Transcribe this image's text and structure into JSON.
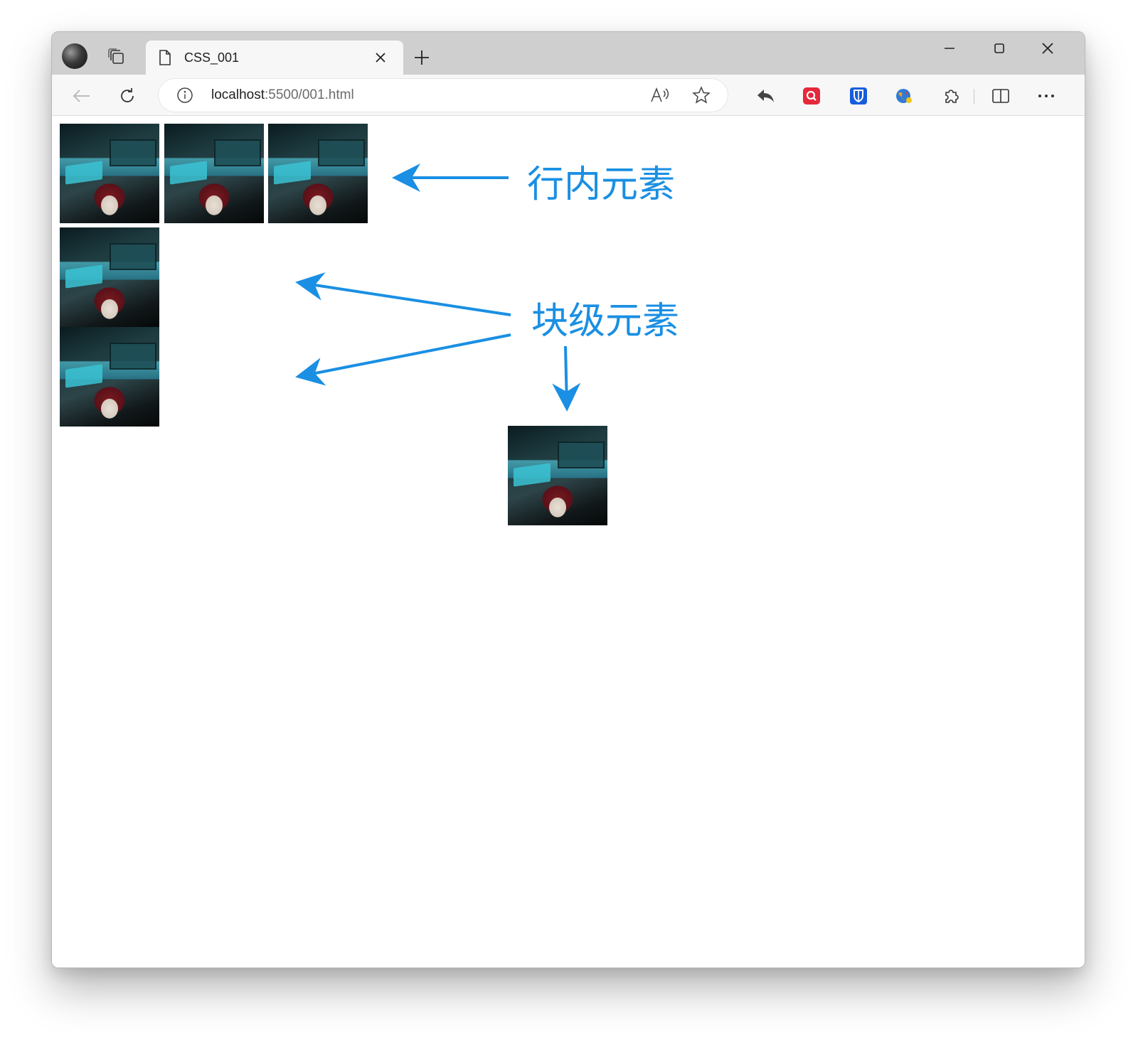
{
  "browser": {
    "tab_title": "CSS_001",
    "address": {
      "host": "localhost",
      "path": ":5500/001.html"
    }
  },
  "page": {
    "annotations": {
      "inline_label": "行内元素",
      "block_label": "块级元素"
    },
    "accent_color": "#1a8fe3"
  },
  "icons": {
    "tabs": "tab-actions-icon",
    "tab_doc": "document-icon",
    "close": "close-icon",
    "new_tab": "plus-icon",
    "back": "back-arrow-icon",
    "reload": "reload-icon",
    "info": "info-icon",
    "read_aloud": "read-aloud-icon",
    "favorite": "star-icon",
    "share": "share-back-icon",
    "extension_red": "red-search-extension-icon",
    "extension_bitwarden": "shield-extension-icon",
    "extension_globe": "globe-extension-icon",
    "extensions": "puzzle-icon",
    "split": "split-screen-icon",
    "more": "more-dots-icon"
  }
}
